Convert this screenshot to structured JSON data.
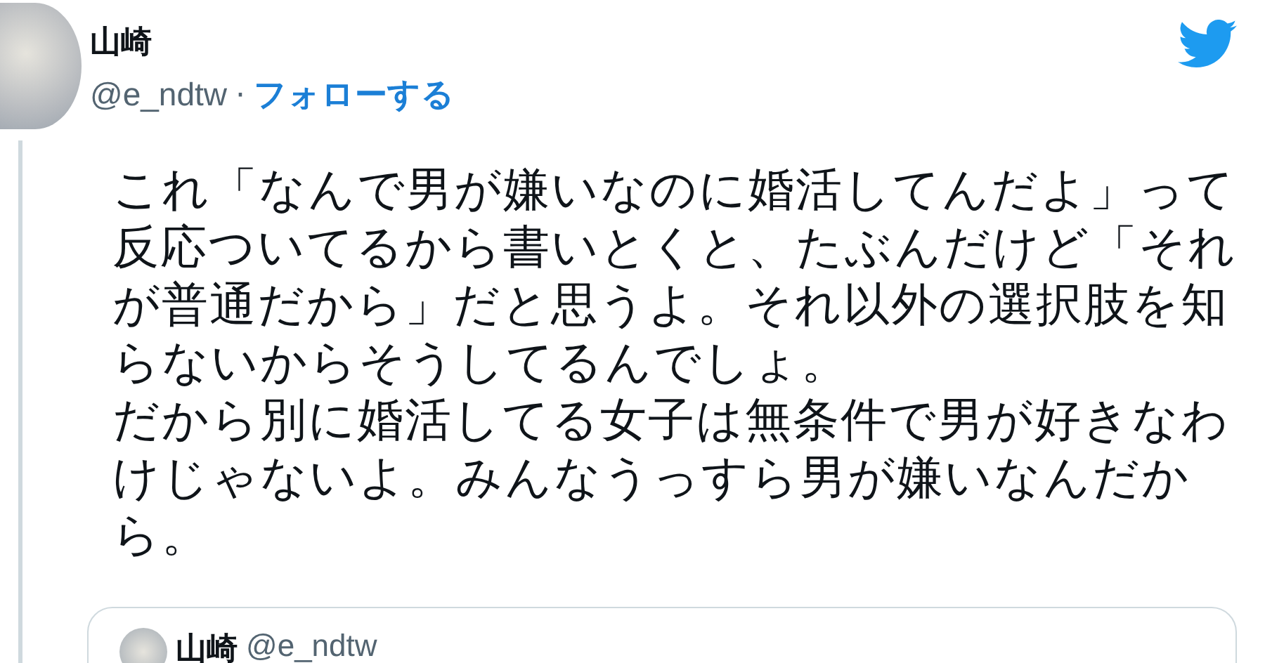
{
  "author": {
    "name": "山崎",
    "handle": "@e_ndtw",
    "separator": "·",
    "follow": "フォローする"
  },
  "body_lines": [
    "これ「なんで男が嫌いなのに婚活してんだよ」って",
    "反応ついてるから書いとくと、たぶんだけど「それ",
    "が普通だから」だと思うよ。それ以外の選択肢を知",
    "らないからそうしてるんでしょ。",
    "だから別に婚活してる女子は無条件で男が好きなわ",
    "けじゃないよ。みんなうっすら男が嫌いなんだか",
    "ら。"
  ],
  "quoted": {
    "name": "山崎",
    "handle": "@e_ndtw"
  }
}
